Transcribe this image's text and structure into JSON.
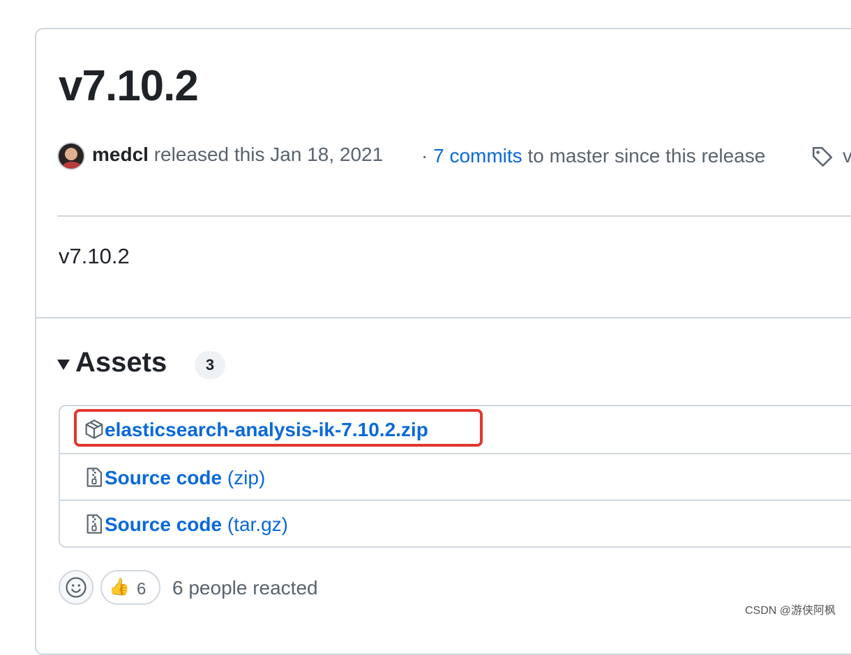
{
  "release": {
    "title": "v7.10.2",
    "author": "medcl",
    "released_text": " released this Jan 18, 2021",
    "commits_prefix": "· ",
    "commits_link": "7 commits",
    "commits_suffix": " to master since this release",
    "tag_label": "v",
    "body": "v7.10.2"
  },
  "assets": {
    "title": "Assets",
    "count": "3",
    "items": [
      {
        "name": "elasticsearch-analysis-ik-7.10.2.zip",
        "suffix": "",
        "icon": "package-icon"
      },
      {
        "name": "Source code",
        "suffix": " (zip)",
        "icon": "file-zip-icon"
      },
      {
        "name": "Source code",
        "suffix": " (tar.gz)",
        "icon": "file-zip-icon"
      }
    ]
  },
  "reactions": {
    "thumbs_emoji": "👍",
    "thumbs_count": "6",
    "summary": "6 people reacted"
  },
  "watermark": "CSDN @游侠阿枫",
  "colors": {
    "link": "#0969da",
    "border": "#d0d7de",
    "highlight": "#e0372f",
    "muted": "#59636e"
  }
}
